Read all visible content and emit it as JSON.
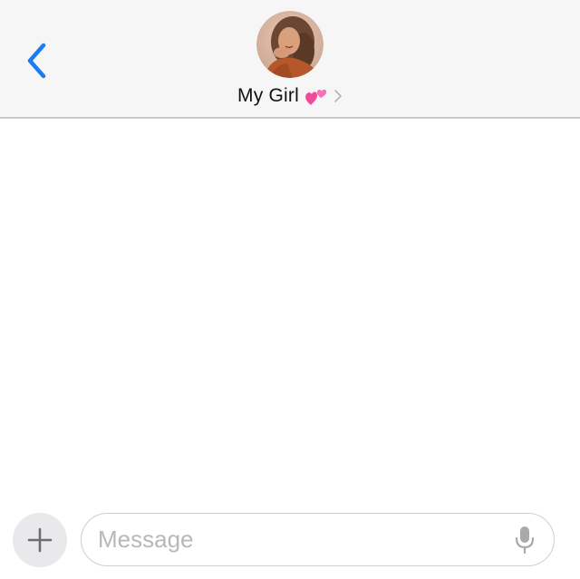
{
  "header": {
    "back_icon": "chevron-left-icon",
    "contact_name": "My Girl",
    "contact_emoji": "two-hearts-icon",
    "disclosure_icon": "chevron-right-icon",
    "avatar": "contact-avatar"
  },
  "composer": {
    "plus_icon": "plus-icon",
    "message_placeholder": "Message",
    "message_value": "",
    "mic_icon": "microphone-icon"
  },
  "colors": {
    "accent": "#1a7cf5",
    "header_bg": "#f6f6f6",
    "divider": "#c9c9c9",
    "placeholder": "#b8b8bc",
    "emoji_pink": "#f04a9a"
  }
}
